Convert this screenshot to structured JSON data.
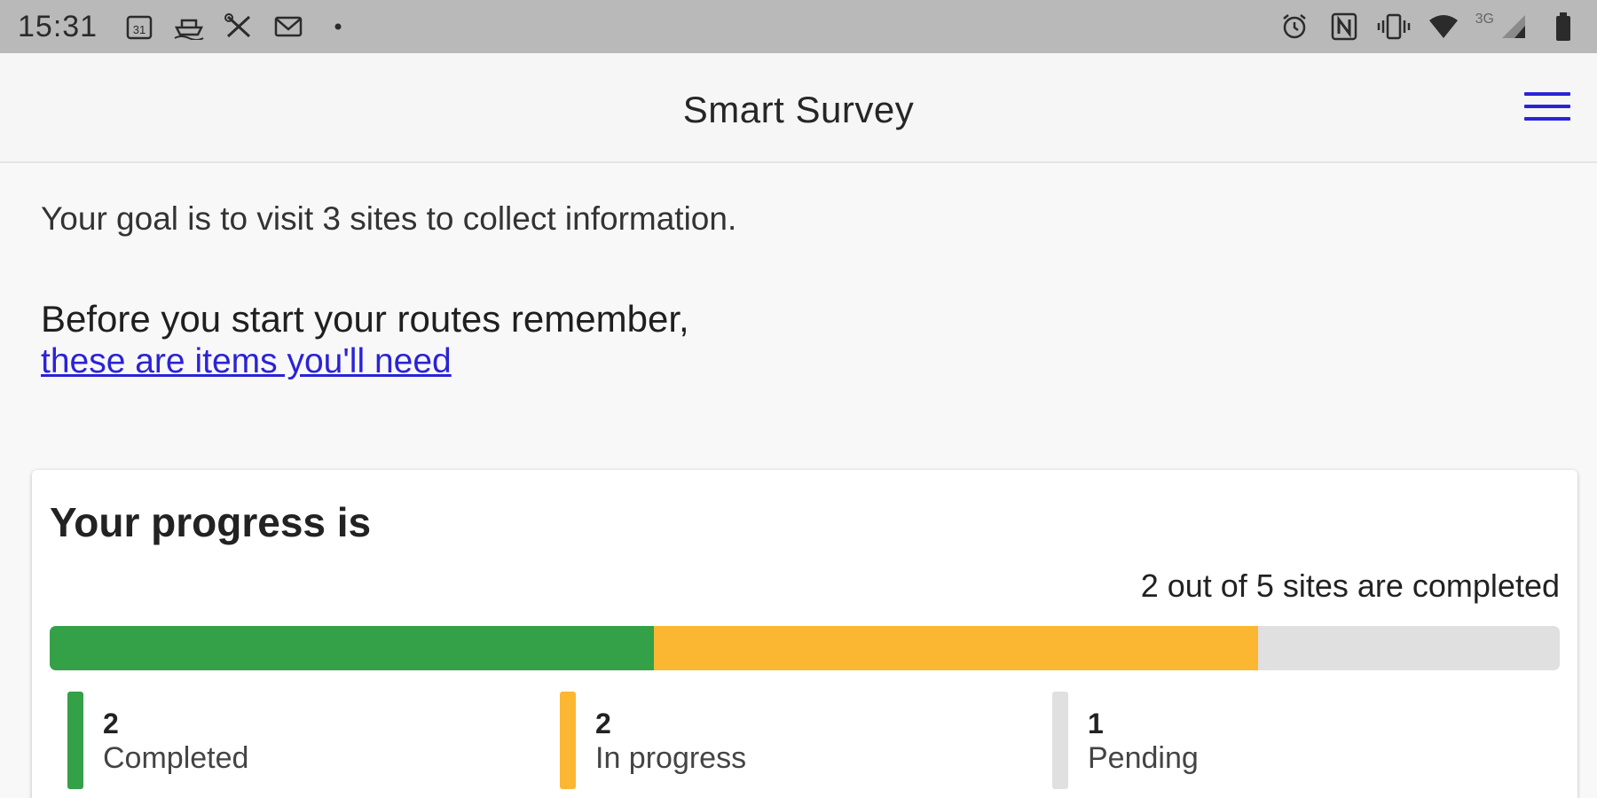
{
  "status_bar": {
    "time": "15:31",
    "left_icons": [
      "calendar-icon",
      "boat-icon",
      "tools-icon",
      "mail-icon",
      "dot-icon"
    ],
    "network_label": "3G",
    "right_icons": [
      "alarm-icon",
      "nfc-icon",
      "vibrate-icon",
      "wifi-icon",
      "signal-icon",
      "battery-icon"
    ]
  },
  "app_bar": {
    "title": "Smart Survey",
    "menu_icon": "hamburger-menu-icon",
    "accent_color": "#2a23d6"
  },
  "intro": {
    "goal": "Your goal is to visit 3 sites to collect information.",
    "reminder": "Before you start your routes remember,",
    "items_link": "these are items you'll need"
  },
  "progress": {
    "heading": "Your progress is",
    "summary": "2 out of 5 sites are completed",
    "total": 5,
    "segments": [
      {
        "key": "completed",
        "count": "2",
        "label": "Completed",
        "value": 2,
        "color": "#34a047"
      },
      {
        "key": "in_progress",
        "count": "2",
        "label": "In progress",
        "value": 2,
        "color": "#fbb732"
      },
      {
        "key": "pending",
        "count": "1",
        "label": "Pending",
        "value": 1,
        "color": "#e0e0e0"
      }
    ]
  }
}
